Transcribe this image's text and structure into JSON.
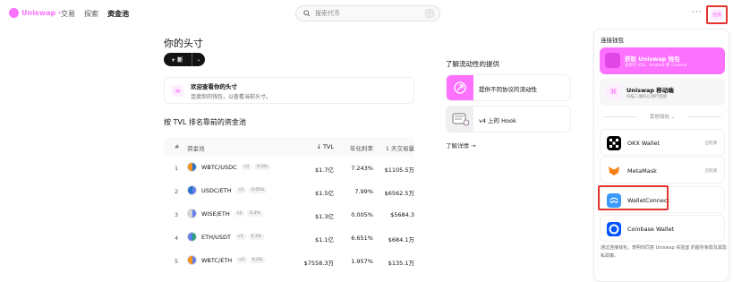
{
  "nav": {
    "brand": "Uniswap",
    "caret": "▾",
    "items": [
      "交易",
      "探索",
      "资金池"
    ],
    "search_placeholder": "搜索代币",
    "search_shortcut": "/",
    "more": "···",
    "connect_label": "连接"
  },
  "main": {
    "title": "你的头寸",
    "new_button": "+ 新",
    "new_chevron": "⌄",
    "welcome_title": "欢迎查看你的头寸",
    "welcome_subtitle": "连接你的钱包，以查看当前头寸。",
    "top_pools_title": "按 TVL 排名靠前的资金池",
    "table": {
      "headers": {
        "index": "#",
        "pool": "资金池",
        "tvl": "↓ TVL",
        "apr": "年化利率",
        "volume": "1 天交易量"
      },
      "rows": [
        {
          "index": "1",
          "pair": "WBTC/USDC",
          "version": "v3",
          "fee": "0.3%",
          "tvl": "$1.7亿",
          "apr": "7.243%",
          "volume": "$1105.5万",
          "c1": "#f7931a",
          "c2": "#2775ca"
        },
        {
          "index": "2",
          "pair": "USDC/ETH",
          "version": "v3",
          "fee": "0.05%",
          "tvl": "$1.5亿",
          "apr": "7.99%",
          "volume": "$6562.5万",
          "c1": "#2775ca",
          "c2": "#627eea"
        },
        {
          "index": "3",
          "pair": "WISE/ETH",
          "version": "v2",
          "fee": "0.3%",
          "tvl": "$1.3亿",
          "apr": "0.005%",
          "volume": "$5684.3",
          "c1": "#d6d6d6",
          "c2": "#627eea"
        },
        {
          "index": "4",
          "pair": "ETH/USDT",
          "version": "v3",
          "fee": "0.3%",
          "tvl": "$1.1亿",
          "apr": "6.651%",
          "volume": "$684.1万",
          "c1": "#627eea",
          "c2": "#26a17b"
        },
        {
          "index": "5",
          "pair": "WBTC/ETH",
          "version": "v3",
          "fee": "0.3%",
          "tvl": "$7558.3万",
          "apr": "1.957%",
          "volume": "$135.1万",
          "c1": "#f7931a",
          "c2": "#627eea"
        }
      ]
    }
  },
  "liquidity": {
    "title": "了解流动性的提供",
    "cards": [
      {
        "label": "提供不同协议的流动性",
        "bg": "#fc72ff"
      },
      {
        "label": "v4 上的 Hook",
        "bg": "#f0f0f0"
      }
    ],
    "learn_more": "了解详情 →"
  },
  "wallet_panel": {
    "title": "连接钱包",
    "uniswap_wallet": {
      "title": "获取 Uniswap 钱包",
      "subtitle": "适用于 iOS、Android 和 Chrome"
    },
    "mobile": {
      "title": "Uniswap 移动端",
      "subtitle": "扫描二维码以进行连接"
    },
    "other_wallets": "其他钱包 ⌄",
    "wallets": [
      {
        "name": "OKX Wallet",
        "status": "已检测",
        "color": "#000000"
      },
      {
        "name": "MetaMask",
        "status": "已检测",
        "color": "#f6851b"
      },
      {
        "name": "WalletConnect",
        "status": "",
        "color": "#3b99fc"
      },
      {
        "name": "Coinbase Wallet",
        "status": "",
        "color": "#0052ff"
      }
    ],
    "terms": "通过连接钱包，表明你同意 Uniswap 实验室 的服务条款及其隐私政策。"
  }
}
